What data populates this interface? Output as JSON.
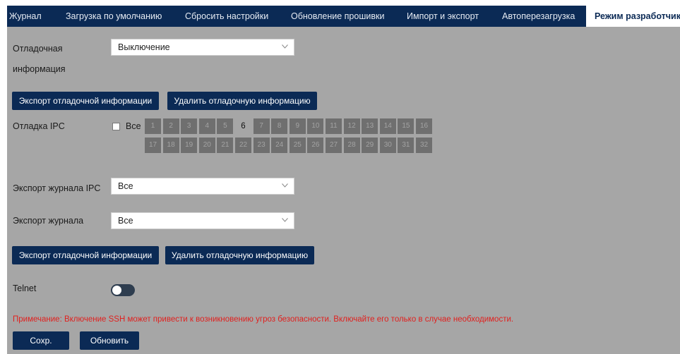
{
  "tabs": [
    {
      "label": "Журнал"
    },
    {
      "label": "Загрузка по умолчанию"
    },
    {
      "label": "Сбросить настройки"
    },
    {
      "label": "Обновление прошивки"
    },
    {
      "label": "Импорт и экспорт"
    },
    {
      "label": "Автоперезагрузка"
    },
    {
      "label": "Режим разработчика"
    }
  ],
  "active_tab": "Режим разработчика",
  "debug_info": {
    "label_line1": "Отладочная",
    "label_line2": "информация",
    "select_value": "Выключение"
  },
  "buttons_top": {
    "export": "Экспорт отладочной информации",
    "delete": "Удалить отладочную информацию"
  },
  "ipc_debug": {
    "label": "Отладка IPC",
    "all_label": "Все",
    "all_checked": false,
    "channels": [
      "1",
      "2",
      "3",
      "4",
      "5",
      "6",
      "7",
      "8",
      "9",
      "10",
      "11",
      "12",
      "13",
      "14",
      "15",
      "16",
      "17",
      "18",
      "19",
      "20",
      "21",
      "22",
      "23",
      "24",
      "25",
      "26",
      "27",
      "28",
      "29",
      "30",
      "31",
      "32"
    ],
    "selected_channel": "6"
  },
  "ipc_log_export": {
    "label": "Экспорт журнала IPC",
    "select_value": "Все"
  },
  "log_export": {
    "label": "Экспорт журнала",
    "select_value": "Все"
  },
  "buttons_bottom": {
    "export": "Экспорт отладочной информации",
    "delete": "Удалить отладочную информацию"
  },
  "telnet": {
    "label": "Telnet",
    "enabled": false
  },
  "note": "Примечание: Включение SSH может привести к возникновению угроз безопасности. Включайте его только в случае необходимости.",
  "actions": {
    "save": "Сохр.",
    "refresh": "Обновить"
  },
  "colors": {
    "nav_bg": "#0b2a55",
    "page_bg": "#a6a6a6",
    "note": "#e0211f",
    "button_bg": "#0b2a55"
  }
}
